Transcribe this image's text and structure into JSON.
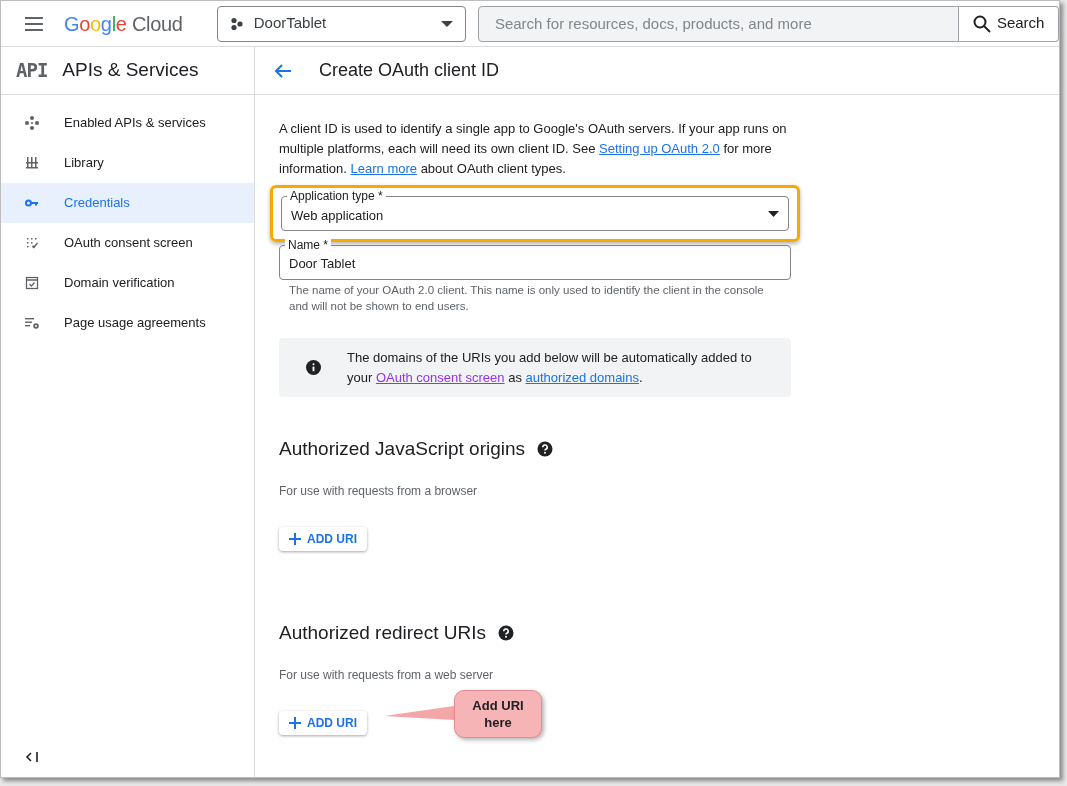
{
  "header": {
    "logo": {
      "brand": "Google",
      "product": "Cloud"
    },
    "project": "DoorTablet",
    "search": {
      "placeholder": "Search for resources, docs, products, and more",
      "button": "Search"
    }
  },
  "sidebar": {
    "badge": "API",
    "title": "APIs & Services",
    "items": [
      {
        "label": "Enabled APIs & services",
        "kind": "move",
        "selected": false
      },
      {
        "label": "Library",
        "kind": "library",
        "selected": false
      },
      {
        "label": "Credentials",
        "kind": "key",
        "selected": true
      },
      {
        "label": "OAuth consent screen",
        "kind": "consent",
        "selected": false
      },
      {
        "label": "Domain verification",
        "kind": "check",
        "selected": false
      },
      {
        "label": "Page usage agreements",
        "kind": "settings",
        "selected": false
      }
    ]
  },
  "page": {
    "title": "Create OAuth client ID",
    "intro": [
      {
        "kind": "text",
        "text": "A client ID is used to identify a single app to Google's OAuth servers. If your app runs on multiple platforms, each will need its own client ID. See "
      },
      {
        "kind": "link",
        "text": "Setting up OAuth 2.0"
      },
      {
        "kind": "text",
        "text": " for more information. "
      },
      {
        "kind": "link",
        "text": "Learn more"
      },
      {
        "kind": "text",
        "text": " about OAuth client types."
      }
    ],
    "application_type": {
      "label": "Application type *",
      "value": "Web application",
      "highlighted": true
    },
    "name": {
      "label": "Name *",
      "value": "Door Tablet",
      "hint": "The name of your OAuth 2.0 client. This name is only used to identify the client in the console and will not be shown to end users."
    },
    "info": [
      {
        "kind": "text",
        "text": "The domains of the URIs you add below will be automatically added to your "
      },
      {
        "kind": "visited_link",
        "text": "OAuth consent screen"
      },
      {
        "kind": "text",
        "text": " as "
      },
      {
        "kind": "link",
        "text": "authorized domains"
      },
      {
        "kind": "text",
        "text": "."
      }
    ],
    "sections": [
      {
        "title": "Authorized JavaScript origins",
        "subtitle": "For use with requests from a browser",
        "button": "ADD URI"
      },
      {
        "title": "Authorized redirect URIs",
        "subtitle": "For use with requests from a web server",
        "button": "ADD URI"
      }
    ],
    "callout": "Add URI here"
  }
}
